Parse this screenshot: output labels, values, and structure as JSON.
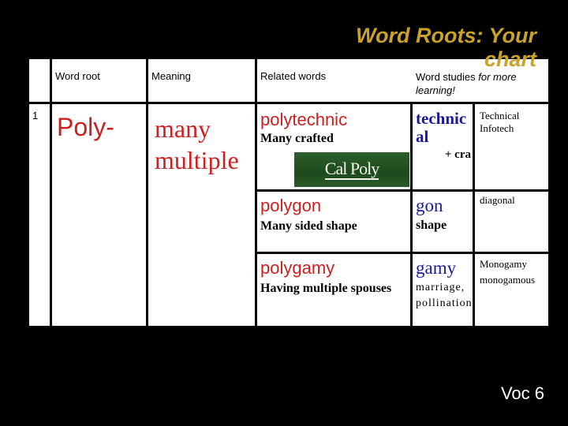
{
  "title": "Word Roots: Your chart",
  "footer": "Voc 6",
  "logo_text": "Cal Poly",
  "headers": {
    "word_root": "Word root",
    "meaning": "Meaning",
    "related": "Related words",
    "studies_plain": "Word studies ",
    "studies_italic": "for more learning!"
  },
  "row": {
    "number": "1",
    "root": "Poly-",
    "meaning_1": "many",
    "meaning_2": "multiple"
  },
  "related": [
    {
      "word": "polytechnic",
      "definition": "Many crafted",
      "study_root": "technic al",
      "study_meaning": "+ cra",
      "extra": [
        "Technical",
        "Infotech"
      ]
    },
    {
      "word": "polygon",
      "definition": "Many sided shape",
      "study_root": "gon",
      "study_meaning": "shape",
      "extra": [
        "diagonal"
      ]
    },
    {
      "word": "polygamy",
      "definition": "Having multiple spouses",
      "study_root": "gamy",
      "study_meaning": "marriage, pollination",
      "extra": [
        "Monogamy",
        "monogamous"
      ]
    }
  ],
  "colors": {
    "title": "#c9a227",
    "root_red": "#cc1f1f",
    "study_blue": "#1a1a99"
  }
}
